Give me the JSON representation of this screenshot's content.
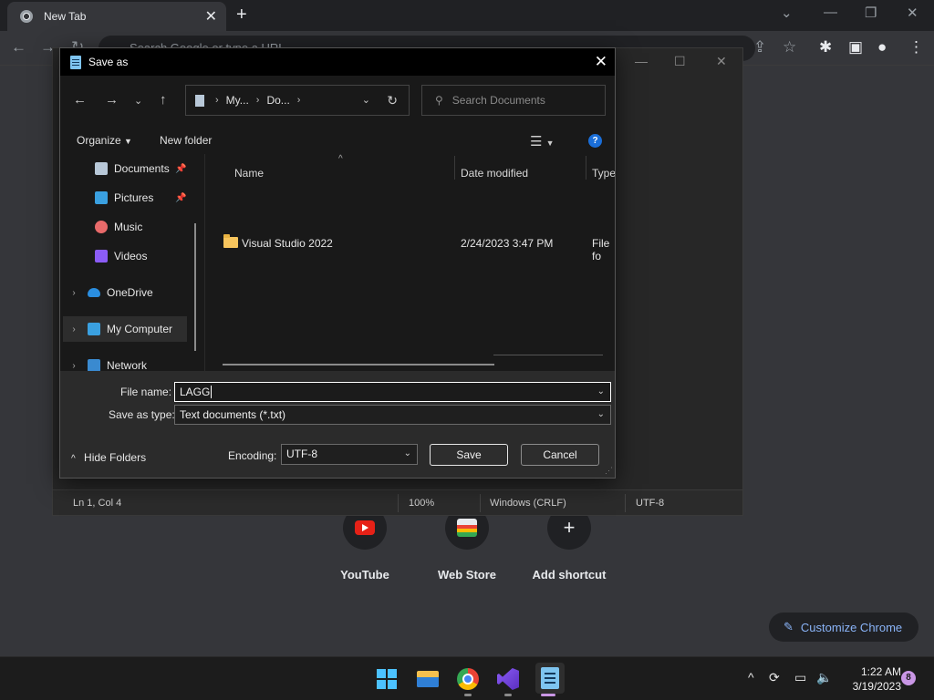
{
  "browser": {
    "tab_title": "New Tab",
    "omnibox_placeholder": "Search Google or type a URL",
    "shortcuts": [
      {
        "label": "YouTube"
      },
      {
        "label": "Web Store"
      },
      {
        "label": "Add shortcut"
      }
    ],
    "customize_label": "Customize Chrome"
  },
  "notepad": {
    "status": {
      "position": "Ln 1, Col 4",
      "zoom": "100%",
      "line_ending": "Windows (CRLF)",
      "encoding": "UTF-8"
    }
  },
  "dialog": {
    "title": "Save as",
    "breadcrumb": [
      "My...",
      "Do..."
    ],
    "search_placeholder": "Search Documents",
    "organize_label": "Organize",
    "new_folder_label": "New folder",
    "help_glyph": "?",
    "nav_items": [
      {
        "label": "Documents",
        "pinned": true
      },
      {
        "label": "Pictures",
        "pinned": true
      },
      {
        "label": "Music"
      },
      {
        "label": "Videos"
      },
      {
        "label": "OneDrive"
      },
      {
        "label": "My Computer",
        "selected": true
      },
      {
        "label": "Network"
      }
    ],
    "columns": {
      "name": "Name",
      "date": "Date modified",
      "type": "Type"
    },
    "files": [
      {
        "name": "Visual Studio 2022",
        "date": "2/24/2023 3:47 PM",
        "type": "File fo"
      }
    ],
    "file_name_label": "File name:",
    "file_name_value": "LAGG",
    "save_type_label": "Save as type:",
    "save_type_value": "Text documents (*.txt)",
    "encoding_label": "Encoding:",
    "encoding_value": "UTF-8",
    "save_label": "Save",
    "cancel_label": "Cancel",
    "hide_folders_label": "Hide Folders"
  },
  "taskbar": {
    "time": "1:22 AM",
    "date": "3/19/2023",
    "notification_count": "8"
  },
  "colors": {
    "accent": "#4cc2ff",
    "chrome_link": "#8ab4f8",
    "badge": "#c996e5"
  }
}
